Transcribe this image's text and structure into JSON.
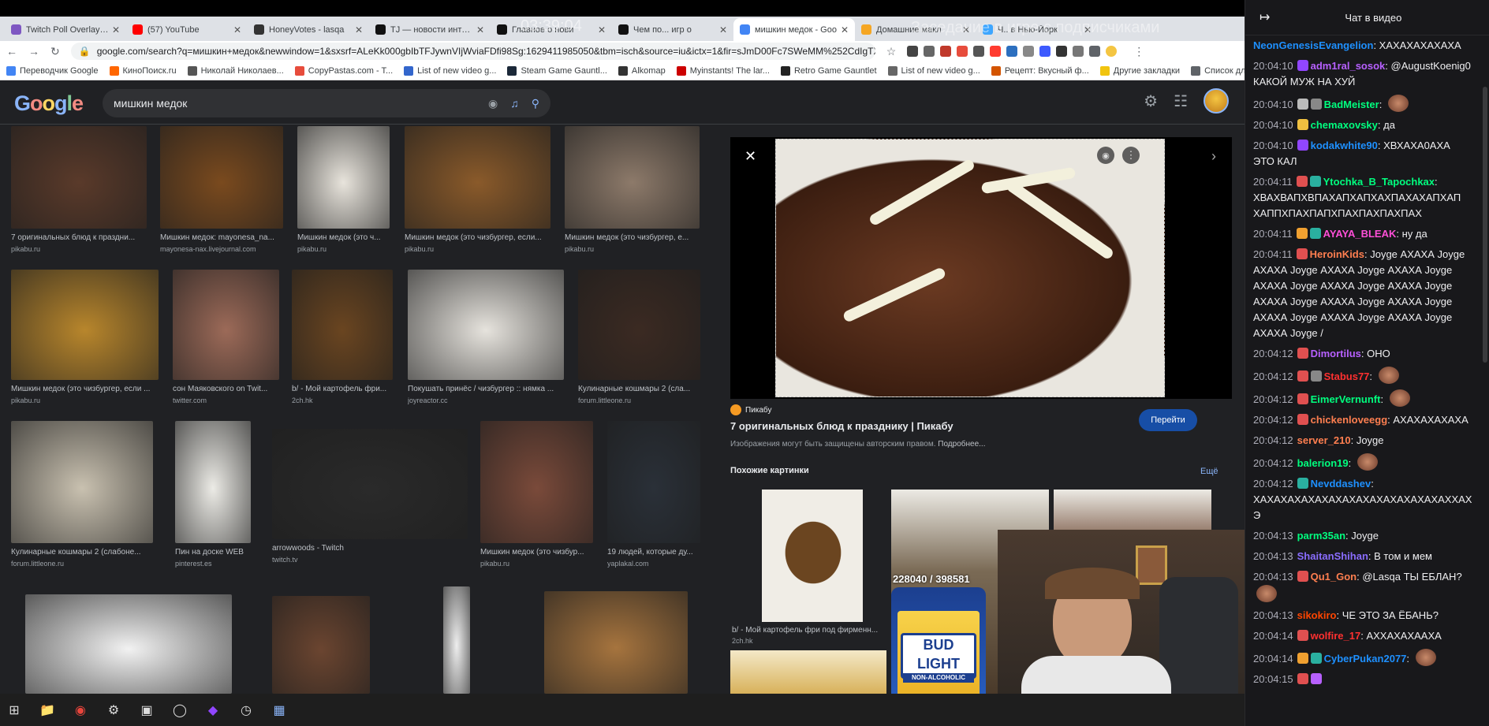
{
  "browser": {
    "tabs": [
      {
        "label": "Twitch Poll Overlay - D",
        "icon_color": "#7e57c2",
        "active": false
      },
      {
        "label": "(57) YouTube",
        "icon_color": "#ff0000",
        "active": false
      },
      {
        "label": "HoneyVotes - lasqa",
        "icon_color": "#333333",
        "active": false
      },
      {
        "label": "TJ — новости интерн",
        "icon_color": "#111111",
        "active": false
      },
      {
        "label": "Главное о нови",
        "icon_color": "#111111",
        "active": false
      },
      {
        "label": "Чем по... игр о",
        "icon_color": "#111111",
        "active": false
      },
      {
        "label": "мишкин медок - Goo",
        "icon_color": "#4285f4",
        "active": true
      },
      {
        "label": "Домашние макл",
        "icon_color": "#f5a623",
        "active": false
      },
      {
        "label": "Ч.. в Нью-Йорк",
        "icon_color": "#3ea6ff",
        "active": false
      }
    ],
    "overlay_time": "03:39:04",
    "overlay_title": "Заседание в игре с подписчиками",
    "url": "google.com/search?q=мишкин+медок&newwindow=1&sxsrf=ALeKk000gbIbTFJywnVIjWviaFDfi98Sg:1629411985050&tbm=isch&source=iu&ictx=1&fir=sJmD00Fc7SWeMM%252CdIgTXCRP96...",
    "bookmarks": [
      {
        "label": "Переводчик Google",
        "color": "#4285f4"
      },
      {
        "label": "КиноПоиск.ru",
        "color": "#ff6600"
      },
      {
        "label": "Николай Николаев...",
        "color": "#555555"
      },
      {
        "label": "CopyPastas.com - T...",
        "color": "#e74c3c"
      },
      {
        "label": "List of new video g...",
        "color": "#3366cc"
      },
      {
        "label": "Steam Game Gauntl...",
        "color": "#1b2838"
      },
      {
        "label": "Alkomap",
        "color": "#333333"
      },
      {
        "label": "Myinstants! The lar...",
        "color": "#cc0000"
      },
      {
        "label": "Retro Game Gauntlet",
        "color": "#222222"
      },
      {
        "label": "List of new video g...",
        "color": "#666666"
      },
      {
        "label": "Рецепт: Вкусный ф...",
        "color": "#d35400"
      },
      {
        "label": "Другие закладки",
        "color": "#f1c40f"
      },
      {
        "label": "Список для чтения",
        "color": "#5f6368"
      }
    ]
  },
  "google": {
    "logo": "Google",
    "query": "мишкин медок"
  },
  "results": [
    {
      "caption": "7 оригинальных блюд к праздни...",
      "source": "pikabu.ru",
      "color": "#5a3a2a"
    },
    {
      "caption": "Мишкин медок: mayonesa_na...",
      "source": "mayonesa-nax.livejournal.com",
      "color": "#7a4a1e"
    },
    {
      "caption": "Мишкин медок (это ч...",
      "source": "pikabu.ru",
      "color": "#e8e4dc"
    },
    {
      "caption": "Мишкин медок (это чизбургер, если...",
      "source": "pikabu.ru",
      "color": "#8a5a2a"
    },
    {
      "caption": "Мишкин медок (это чизбургер, е...",
      "source": "pikabu.ru",
      "color": "#8d7a6a"
    },
    {
      "caption": "Мишкин медок (это чизбургер, если ...",
      "source": "pikabu.ru",
      "color": "#b8862c"
    },
    {
      "caption": "сон Маяковского on Twit...",
      "source": "twitter.com",
      "color": "#9c6a58"
    },
    {
      "caption": "b/ - Мой картофель фри...",
      "source": "2ch.hk",
      "color": "#6a4520"
    },
    {
      "caption": "Покушать принёс / чизбургер :: нямка ...",
      "source": "joyreactor.cc",
      "color": "#e6e3dd"
    },
    {
      "caption": "Кулинарные кошмары 2 (сла...",
      "source": "forum.littleone.ru",
      "color": "#3b2a22"
    },
    {
      "caption": "Кулинарные кошмары 2 (слабоне...",
      "source": "forum.littleone.ru",
      "color": "#c9c1b0"
    },
    {
      "caption": "Пин на доске WEB",
      "source": "pinterest.es",
      "color": "#ecebe6"
    },
    {
      "caption": "arrowwoods - Twitch",
      "source": "twitch.tv",
      "color": "#2a2a2a"
    },
    {
      "caption": "Мишкин медок (это чизбур...",
      "source": "pikabu.ru",
      "color": "#7a4a3a"
    },
    {
      "caption": "19 людей, которые ду...",
      "source": "yaplakal.com",
      "color": "#2a3038"
    },
    {
      "caption": "",
      "source": "",
      "color": "#f2f2f2"
    },
    {
      "caption": "",
      "source": "",
      "color": "#6b4530"
    },
    {
      "caption": "",
      "source": "",
      "color": "#eeeeee"
    },
    {
      "caption": "",
      "source": "",
      "color": "#a6743e"
    }
  ],
  "preview": {
    "site": "Пикабу",
    "title": "7 оригинальных блюд к празднику | Пикабу",
    "open_label": "Перейти",
    "copyright": "Изображения могут быть защищены авторским правом.",
    "more_info": "Подробнее...",
    "similar_label": "Похожие картинки",
    "similar_more": "Ещё",
    "similar": [
      {
        "caption": "b/ - Мой картофель фри под фирменн...",
        "source": "2ch.hk"
      }
    ]
  },
  "stream_overlay": {
    "subs_counter": "228040 / 398581",
    "beer_label": "BUD LIGHT",
    "beer_sub": "NON-ALCOHOLIC"
  },
  "chat": {
    "title": "Чат в видео",
    "messages": [
      {
        "time": "",
        "nick": "NeonGenesisEvangelion",
        "nick_color": "#1e90ff",
        "text": "ХАХАХАХАХАХА",
        "badges": []
      },
      {
        "time": "20:04:10",
        "nick": "adm1ral_sosok",
        "nick_color": "#b760ff",
        "text": "@AugustKoenig0 КАКОЙ МУЖ НА ХУЙ",
        "badges": [
          "#9146ff"
        ]
      },
      {
        "time": "20:04:10",
        "nick": "BadMeister",
        "nick_color": "#00ff7f",
        "text": "",
        "badges": [
          "#bbbbbb",
          "#888888"
        ],
        "emote": true
      },
      {
        "time": "20:04:10",
        "nick": "chemaxovsky",
        "nick_color": "#00ff7f",
        "text": "да",
        "badges": [
          "#f0c040"
        ]
      },
      {
        "time": "20:04:10",
        "nick": "kodakwhite90",
        "nick_color": "#1e90ff",
        "text": "ХВХАХА0АХА ЭТО КАЛ",
        "badges": [
          "#9146ff"
        ]
      },
      {
        "time": "20:04:11",
        "nick": "Ytochka_B_Tapochkax",
        "nick_color": "#00ff7f",
        "text": "ХВАХВАПХВПАХАПХАПХАХПАХАХАПХАП ХАППХПАХПАПХПАХПАХПАХПАХ",
        "badges": [
          "#e05050",
          "#2ab0a0"
        ]
      },
      {
        "time": "20:04:11",
        "nick": "AYAYA_BLEAK",
        "nick_color": "#ff4fd8",
        "text": "ну да",
        "badges": [
          "#f0a030",
          "#2ab0a0"
        ]
      },
      {
        "time": "20:04:11",
        "nick": "HeroinKids",
        "nick_color": "#ff7f50",
        "text": "Joyge АХАХА Joyge АХАХА Joyge АХАХА Joyge АХАХА Joyge АХАХА Joyge АХАХА Joyge АХАХА Joyge АХАХА Joyge АХАХА Joyge АХАХА Joyge АХАХА Joyge АХАХА Joyge АХАХА Joyge АХАХА Joyge /",
        "badges": [
          "#e05050"
        ]
      },
      {
        "time": "20:04:12",
        "nick": "Dimortilus",
        "nick_color": "#b760ff",
        "text": "ОНО",
        "badges": [
          "#e05050"
        ]
      },
      {
        "time": "20:04:12",
        "nick": "Stabus77",
        "nick_color": "#ff3030",
        "text": "",
        "badges": [
          "#e05050",
          "#888888"
        ],
        "emote": true
      },
      {
        "time": "20:04:12",
        "nick": "EimerVernunft",
        "nick_color": "#00ff7f",
        "text": "",
        "badges": [
          "#e05050"
        ],
        "emote": true
      },
      {
        "time": "20:04:12",
        "nick": "chickenloveegg",
        "nick_color": "#ff7f50",
        "text": "АХАХАХАХАХА",
        "badges": [
          "#e05050"
        ]
      },
      {
        "time": "20:04:12",
        "nick": "server_210",
        "nick_color": "#ff7f50",
        "text": "Joyge",
        "badges": []
      },
      {
        "time": "20:04:12",
        "nick": "balerion19",
        "nick_color": "#00ff7f",
        "text": "",
        "badges": [],
        "emote": true
      },
      {
        "time": "20:04:12",
        "nick": "Nevddashev",
        "nick_color": "#1e90ff",
        "text": "ХАХАХАХАХАХАХАХАХАХАХАХАХАХАХХАХЭ",
        "badges": [
          "#2ab0a0"
        ]
      },
      {
        "time": "20:04:13",
        "nick": "parm35an",
        "nick_color": "#00ff7f",
        "text": "Joyge",
        "badges": []
      },
      {
        "time": "20:04:13",
        "nick": "ShaitanShihan",
        "nick_color": "#8a6dff",
        "text": "В том и мем",
        "badges": []
      },
      {
        "time": "20:04:13",
        "nick": "Qu1_Gon",
        "nick_color": "#ff7f50",
        "text": "@Lasqa ТЫ ЕБЛАН?",
        "badges": [
          "#e05050"
        ],
        "emote": true
      },
      {
        "time": "20:04:13",
        "nick": "sikokiro",
        "nick_color": "#ff4500",
        "text": "ЧЕ ЭТО ЗА ЁБАНЬ?",
        "badges": []
      },
      {
        "time": "20:04:14",
        "nick": "wolfire_17",
        "nick_color": "#ff3030",
        "text": "АХХАХАХААХА",
        "badges": [
          "#e05050"
        ]
      },
      {
        "time": "20:04:14",
        "nick": "CyberPukan2077",
        "nick_color": "#1e90ff",
        "text": "",
        "badges": [
          "#f0a030",
          "#2ab0a0"
        ],
        "emote": true
      },
      {
        "time": "20:04:15",
        "nick": "",
        "nick_color": "#ffffff",
        "text": "",
        "badges": [
          "#e05050",
          "#b760ff"
        ]
      }
    ]
  }
}
